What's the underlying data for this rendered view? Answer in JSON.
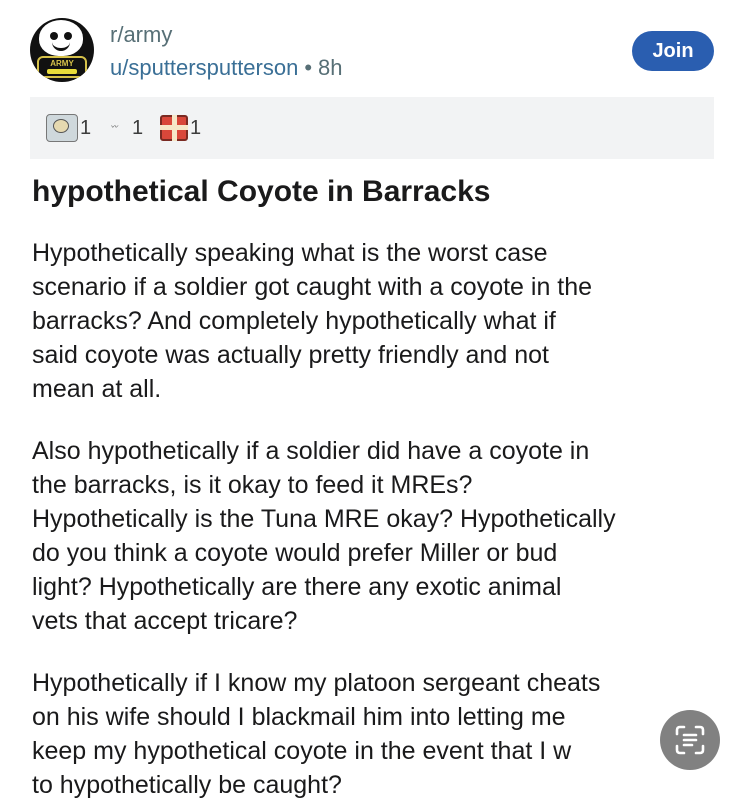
{
  "post": {
    "subreddit": "r/army",
    "author": "u/sputtersputterson",
    "separator": "•",
    "age": "8h",
    "join_label": "Join",
    "avatar_text": "ARMY",
    "awards": [
      {
        "icon": "eagle-award-icon",
        "count": "1"
      },
      {
        "icon": "signature-award-icon",
        "count": "1"
      },
      {
        "icon": "gift-award-icon",
        "count": "1"
      }
    ],
    "title": "hypothetical Coyote in Barracks",
    "paragraphs": [
      [
        "Hypothetically speaking what is the worst case",
        "scenario if a soldier got caught with a coyote in the",
        "barracks? And completely hypothetically what if",
        "said coyote was actually pretty friendly and not",
        "mean at all."
      ],
      [
        "Also hypothetically if a soldier did have a coyote in",
        "the barracks, is it okay to feed it MREs?",
        "Hypothetically is the Tuna MRE okay? Hypothetically",
        "do you think a coyote would prefer Miller or bud",
        "light? Hypothetically are there any exotic animal",
        "vets that accept tricare?"
      ],
      [
        "Hypothetically if I know my platoon sergeant cheats",
        "on his wife should I blackmail him into letting me",
        "keep my hypothetical coyote in the event that I w",
        "to hypothetically be caught?"
      ]
    ]
  },
  "overlay": {
    "icon": "live-text-scan-icon"
  },
  "colors": {
    "join_button": "#2a5eb0",
    "author_link": "#3a6f96",
    "meta_text": "#576f76",
    "awards_bg": "#f2f3f4"
  }
}
